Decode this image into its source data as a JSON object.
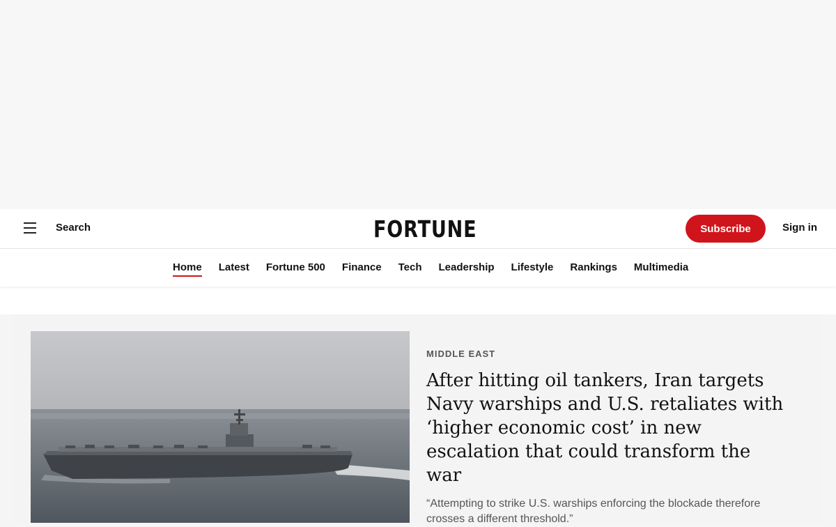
{
  "header": {
    "menu_label": "Menu",
    "search_label": "Search",
    "logo_text": "FORTUNE",
    "subscribe_label": "Subscribe",
    "signin_label": "Sign in"
  },
  "nav": {
    "items": [
      "Home",
      "Latest",
      "Fortune 500",
      "Finance",
      "Tech",
      "Leadership",
      "Lifestyle",
      "Rankings",
      "Multimedia"
    ],
    "active": "Home"
  },
  "hero": {
    "section": "MIDDLE EAST",
    "headline": "After hitting oil tankers, Iran targets Navy warships and U.S. retaliates with ‘higher economic cost’ in new escalation that could transform the war",
    "dek": "“Attempting to strike U.S. warships enforcing the blockade therefore crosses a different threshold.”",
    "image_alt": "aircraft carrier at sea"
  },
  "colors": {
    "brand_red": "#d0141b",
    "text": "#111111",
    "muted": "#555555"
  }
}
